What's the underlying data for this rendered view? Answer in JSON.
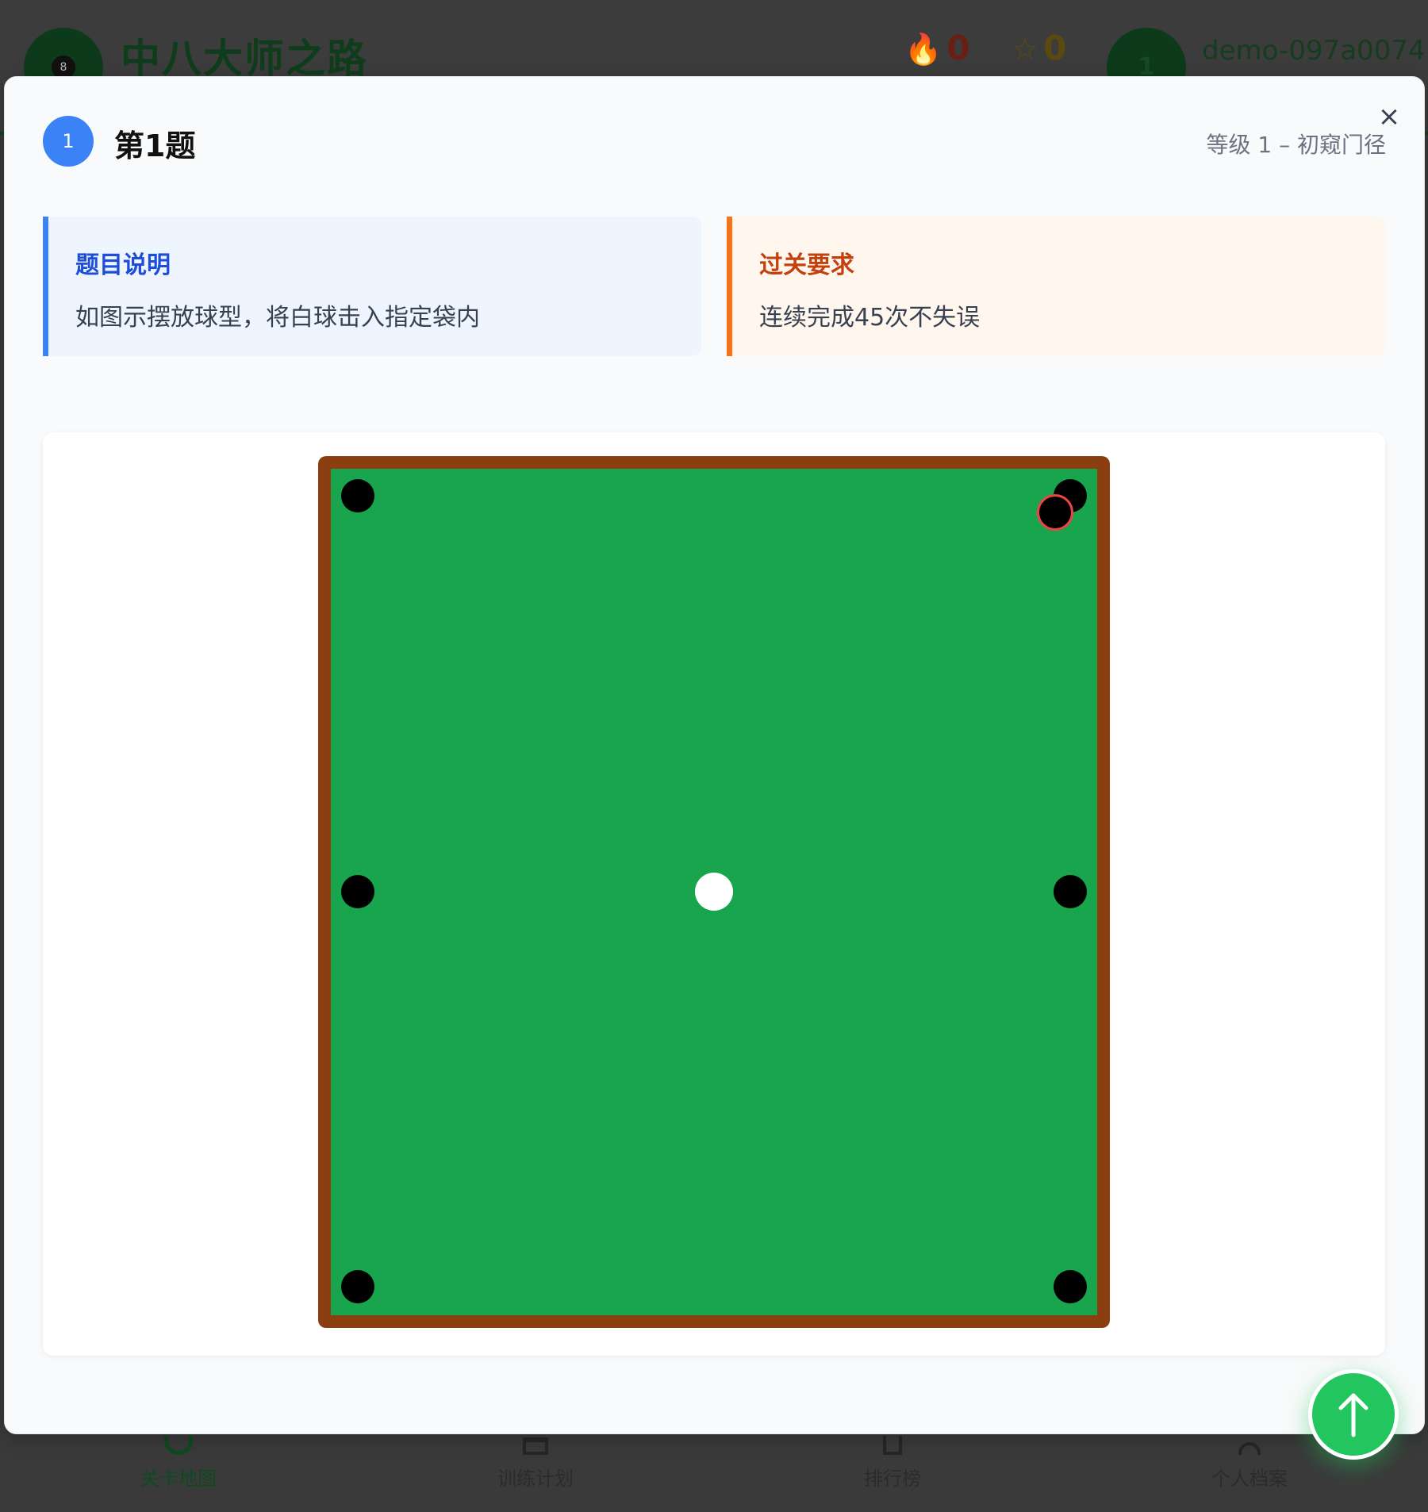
{
  "app": {
    "title": "中八大师之路",
    "logo_ball_number": "8",
    "streak": {
      "icon": "fire-icon",
      "value": "0"
    },
    "stars": {
      "icon": "star-icon",
      "value": "0"
    },
    "user": {
      "avatar_text": "1",
      "name": "demo-097a0074"
    }
  },
  "bottom_nav": [
    {
      "label": "关卡地图",
      "icon": "target-icon",
      "active": true
    },
    {
      "label": "训练计划",
      "icon": "calendar-icon",
      "active": false
    },
    {
      "label": "排行榜",
      "icon": "trophy-icon",
      "active": false
    },
    {
      "label": "个人档案",
      "icon": "person-icon",
      "active": false
    }
  ],
  "modal": {
    "number": "1",
    "title": "第1题",
    "level": "等级 1 – 初窥门径",
    "close_icon": "close-icon",
    "description": {
      "heading": "题目说明",
      "text": "如图示摆放球型，将白球击入指定袋内"
    },
    "requirement": {
      "heading": "过关要求",
      "text": "连续完成45次不失误"
    },
    "table": {
      "felt_color": "#19a54d",
      "rail_color": "#8b3f10",
      "pockets": [
        "top-left",
        "top-right",
        "middle-left",
        "middle-right",
        "bottom-left",
        "bottom-right"
      ],
      "cue_ball": "center",
      "target_pocket": "top-right",
      "target_marker_color": "#ef4444"
    },
    "fab_icon": "arrow-up-icon",
    "fab_color": "#22c55e"
  }
}
